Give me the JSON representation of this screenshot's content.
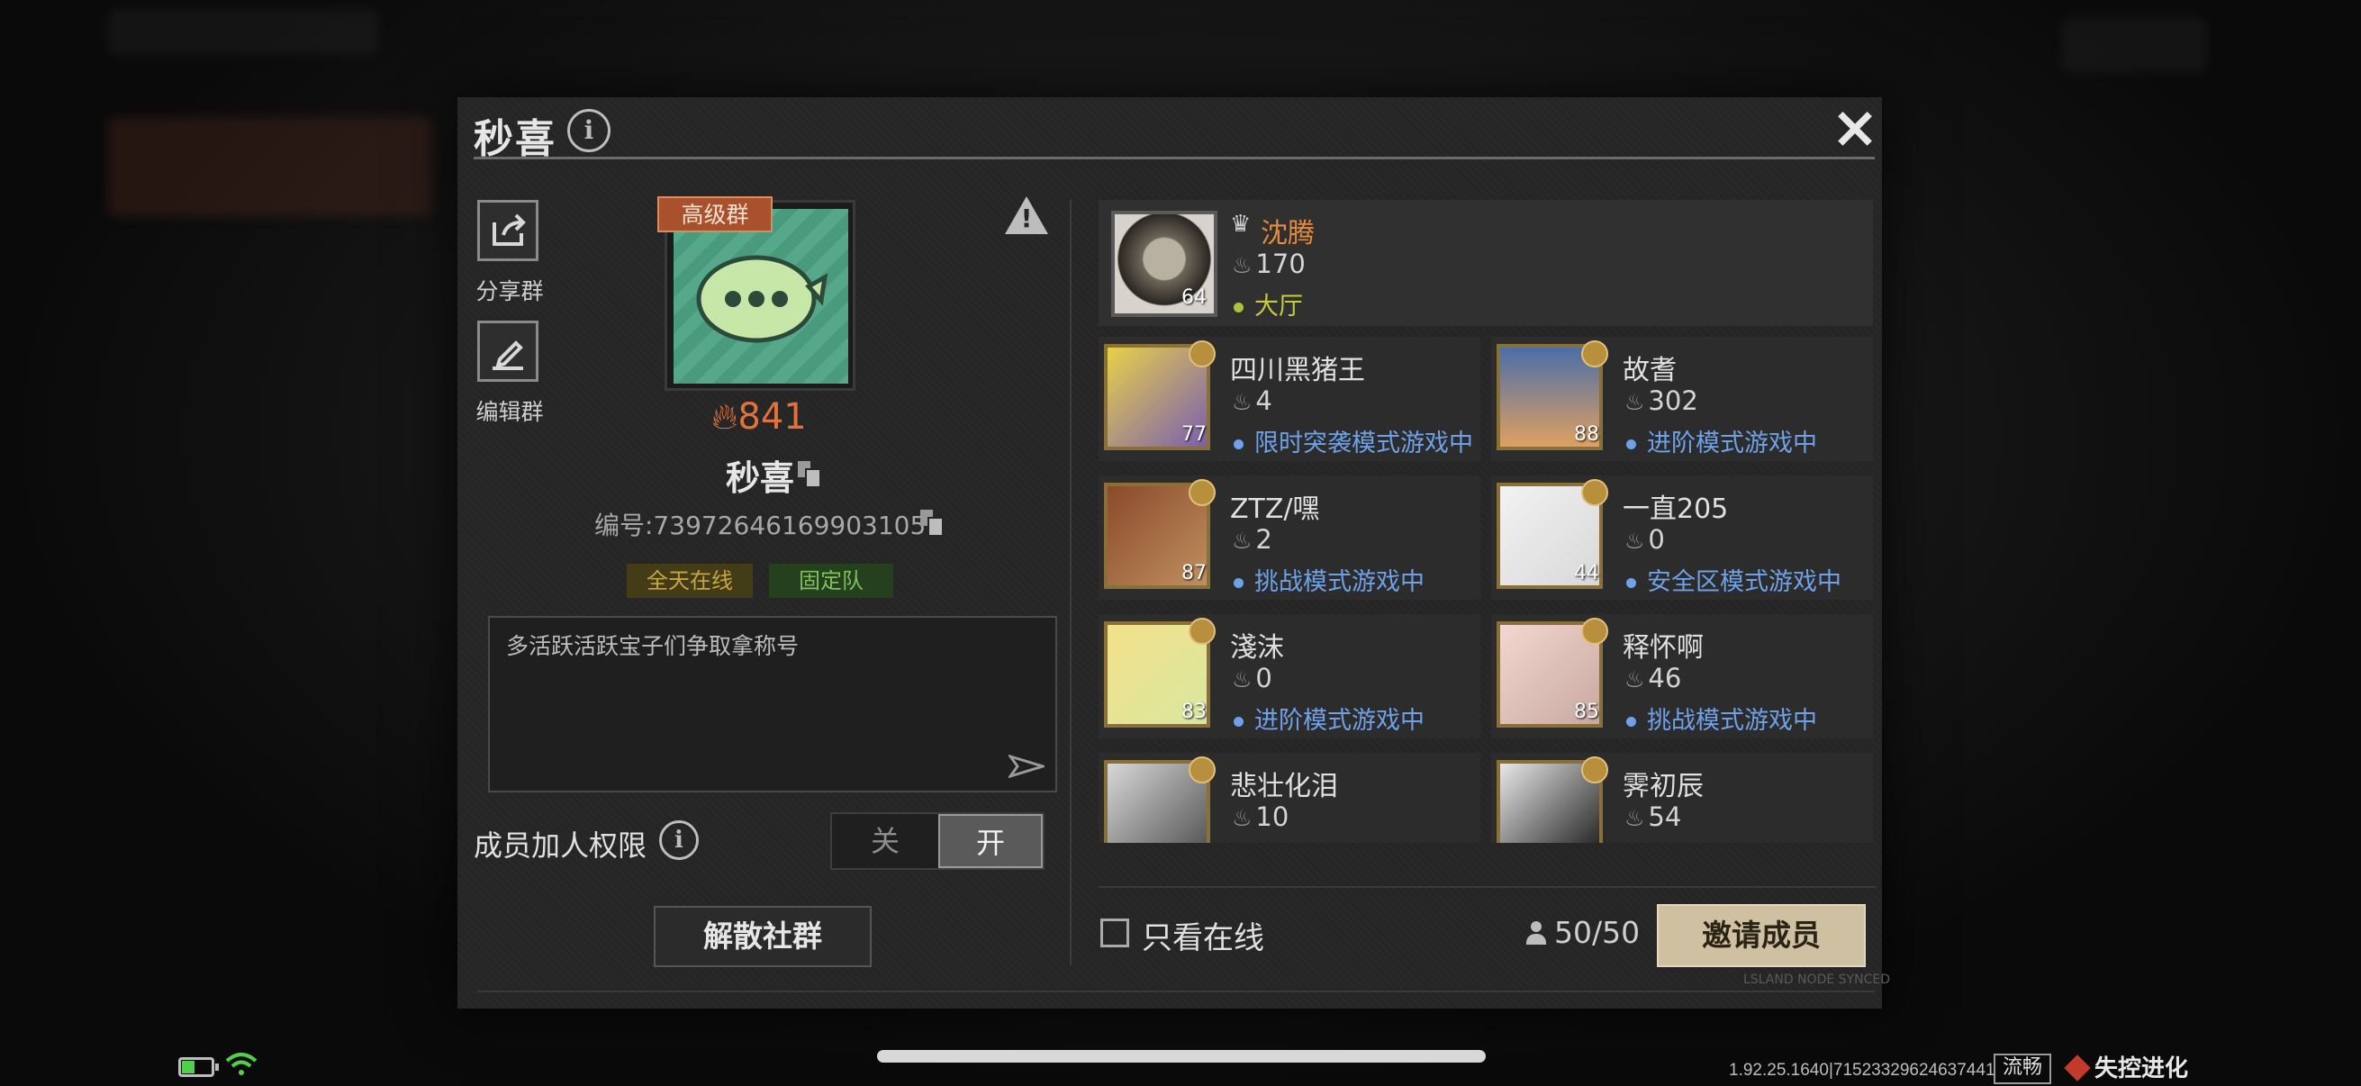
{
  "dialog": {
    "title": "秒喜",
    "close_label": "×"
  },
  "side_actions": [
    {
      "label": "分享群",
      "icon": "share-icon"
    },
    {
      "label": "编辑群",
      "icon": "pencil-icon"
    }
  ],
  "group": {
    "badge": "高级群",
    "heat": "841",
    "name": "秒喜",
    "id_text": "编号:73972646169903105",
    "tags": [
      "全天在线",
      "固定队"
    ],
    "notice": "多活跃活跃宝子们争取拿称号"
  },
  "permission": {
    "label": "成员加人权限",
    "off_label": "关",
    "on_label": "开",
    "selected": "开"
  },
  "dissolve_label": "解散社群",
  "owner": {
    "name": "沈腾",
    "heat": "170",
    "status": "大厅",
    "level": "64"
  },
  "members": [
    {
      "name": "四川黑猪王",
      "heat": "4",
      "status": "限时突袭模式游戏中",
      "level": "77"
    },
    {
      "name": "故耆",
      "heat": "302",
      "status": "进阶模式游戏中",
      "level": "88"
    },
    {
      "name": "ZTZ/嘿",
      "heat": "2",
      "status": "挑战模式游戏中",
      "level": "87"
    },
    {
      "name": "一直205",
      "heat": "0",
      "status": "安全区模式游戏中",
      "level": "44"
    },
    {
      "name": "淺沫",
      "heat": "0",
      "status": "进阶模式游戏中",
      "level": "83"
    },
    {
      "name": "释怀啊",
      "heat": "46",
      "status": "挑战模式游戏中",
      "level": "85"
    },
    {
      "name": "悲壮化泪",
      "heat": "10",
      "status": "",
      "level": ""
    },
    {
      "name": "霁初辰",
      "heat": "54",
      "status": "",
      "level": ""
    }
  ],
  "footer": {
    "online_only_label": "只看在线",
    "member_count": "50/50",
    "invite_label": "邀请成员",
    "sync_label": "LSLAND NODE SYNCED"
  },
  "statusbar": {
    "version": "1.92.25.1640|71523329624637441",
    "network": "流畅",
    "logo_text": "失控进化"
  },
  "colors": {
    "accent_orange": "#e0723a",
    "status_blue": "#6ea1e8",
    "lobby_green": "#a9c33a",
    "invite_bg": "#cfc0a2"
  }
}
